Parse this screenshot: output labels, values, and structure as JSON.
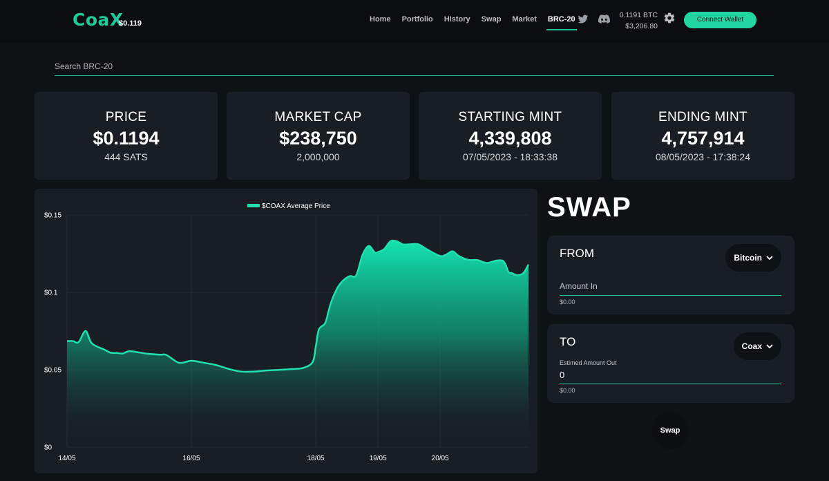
{
  "header": {
    "logo": "CoaX",
    "logo_price": "$0.119",
    "nav": [
      "Home",
      "Portfolio",
      "History",
      "Swap",
      "Market",
      "BRC-20"
    ],
    "active_nav": "BRC-20",
    "balance_btc": "0.1191 BTC",
    "balance_usd": "$3,206.80",
    "connect_label": "Connect Wallet",
    "accent": "#22c99a"
  },
  "search": {
    "placeholder": "Search BRC-20"
  },
  "stats": [
    {
      "label": "PRICE",
      "value": "$0.1194",
      "sub": "444 SATS"
    },
    {
      "label": "MARKET CAP",
      "value": "$238,750",
      "sub": "2,000,000"
    },
    {
      "label": "STARTING MINT",
      "value": "4,339,808",
      "sub": "07/05/2023 - 18:33:38"
    },
    {
      "label": "ENDING MINT",
      "value": "4,757,914",
      "sub": "08/05/2023 - 17:38:24"
    }
  ],
  "chart_data": {
    "type": "area",
    "series": [
      {
        "name": "$COAX Average Price",
        "color": "#22e0b0",
        "x": [
          14.0,
          14.1,
          14.15,
          14.2,
          14.3,
          14.4,
          14.6,
          14.7,
          14.8,
          14.9,
          15.0,
          15.15,
          15.3,
          15.5,
          15.6,
          15.8,
          16.0,
          16.2,
          16.4,
          16.6,
          16.8,
          17.0,
          17.2,
          17.4,
          17.6,
          17.8,
          17.95,
          18.0,
          18.05,
          18.15,
          18.2,
          18.25,
          18.35,
          18.45,
          18.55,
          18.65,
          18.75,
          18.85,
          18.95,
          19.0,
          19.1,
          19.2,
          19.3,
          19.4,
          19.5,
          19.65,
          19.8,
          20.0,
          20.1,
          20.2,
          20.3,
          20.45,
          20.6,
          20.75,
          20.9,
          21.0,
          21.05,
          21.1,
          21.15,
          21.2,
          21.25,
          21.3,
          21.35,
          21.42
        ],
        "y": [
          0.0685,
          0.0685,
          0.0675,
          0.0685,
          0.075,
          0.067,
          0.063,
          0.061,
          0.0608,
          0.0605,
          0.062,
          0.0612,
          0.0603,
          0.0597,
          0.0595,
          0.0545,
          0.0558,
          0.0545,
          0.053,
          0.0505,
          0.0488,
          0.0488,
          0.0495,
          0.0499,
          0.0504,
          0.0512,
          0.055,
          0.065,
          0.076,
          0.08,
          0.087,
          0.094,
          0.103,
          0.108,
          0.1105,
          0.111,
          0.124,
          0.13,
          0.1257,
          0.126,
          0.128,
          0.133,
          0.133,
          0.131,
          0.131,
          0.131,
          0.1275,
          0.1235,
          0.1245,
          0.1265,
          0.1235,
          0.121,
          0.1208,
          0.119,
          0.1205,
          0.1205,
          0.118,
          0.113,
          0.1125,
          0.1115,
          0.111,
          0.1115,
          0.113,
          0.118
        ]
      }
    ],
    "x_ticks": [
      {
        "label": "14/05",
        "value": 14
      },
      {
        "label": "16/05",
        "value": 16
      },
      {
        "label": "18/05",
        "value": 18
      },
      {
        "label": "19/05",
        "value": 19
      },
      {
        "label": "20/05",
        "value": 20
      }
    ],
    "y_ticks": [
      {
        "label": "$0",
        "value": 0
      },
      {
        "label": "$0.05",
        "value": 0.05
      },
      {
        "label": "$0.1",
        "value": 0.1
      },
      {
        "label": "$0.15",
        "value": 0.15
      }
    ],
    "ylim": [
      0,
      0.15
    ],
    "grid": true,
    "legend_position": "top"
  },
  "swap": {
    "title": "SWAP",
    "from": {
      "heading": "FROM",
      "token": "Bitcoin",
      "field_label": "Amount In",
      "usd": "$0.00"
    },
    "to": {
      "heading": "TO",
      "token": "Coax",
      "field_label": "Estimed Amount Out",
      "value": "0",
      "usd": "$0.00"
    },
    "button": "Swap"
  }
}
